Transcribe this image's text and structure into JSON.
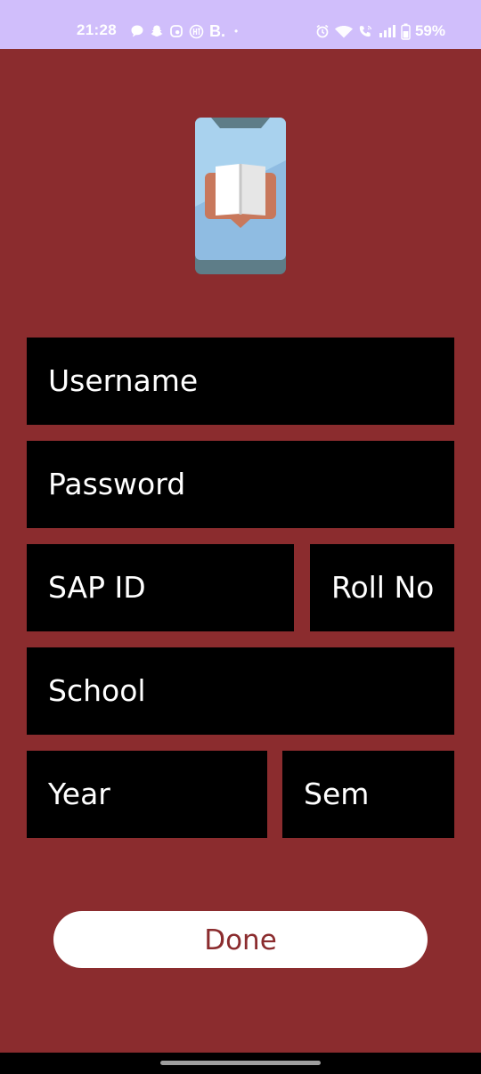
{
  "status_bar": {
    "time": "21:28",
    "left_icons": [
      "chat-bubble-icon",
      "snapchat-icon",
      "messenger-icon",
      "hindustan-times-icon",
      "bold-b-icon",
      "more-notifications-dot-icon"
    ],
    "b_label": "B.",
    "dot": "•",
    "right_icons": [
      "alarm-icon",
      "wifi-icon",
      "wifi-calling-icon",
      "signal-icon",
      "battery-icon"
    ],
    "battery": "59%"
  },
  "logo": {
    "icon": "phone-book-icon"
  },
  "form": {
    "username": "Username",
    "password": "Password",
    "sap_id": "SAP ID",
    "roll_no": "Roll No",
    "school": "School",
    "year": "Year",
    "sem": "Sem"
  },
  "done_label": "Done",
  "colors": {
    "background": "#8B2C2E",
    "status_bar": "#D0BEFB",
    "field": "#000000",
    "field_text": "#FFFFFF",
    "button": "#FFFFFF",
    "button_text": "#8B2C2E"
  }
}
